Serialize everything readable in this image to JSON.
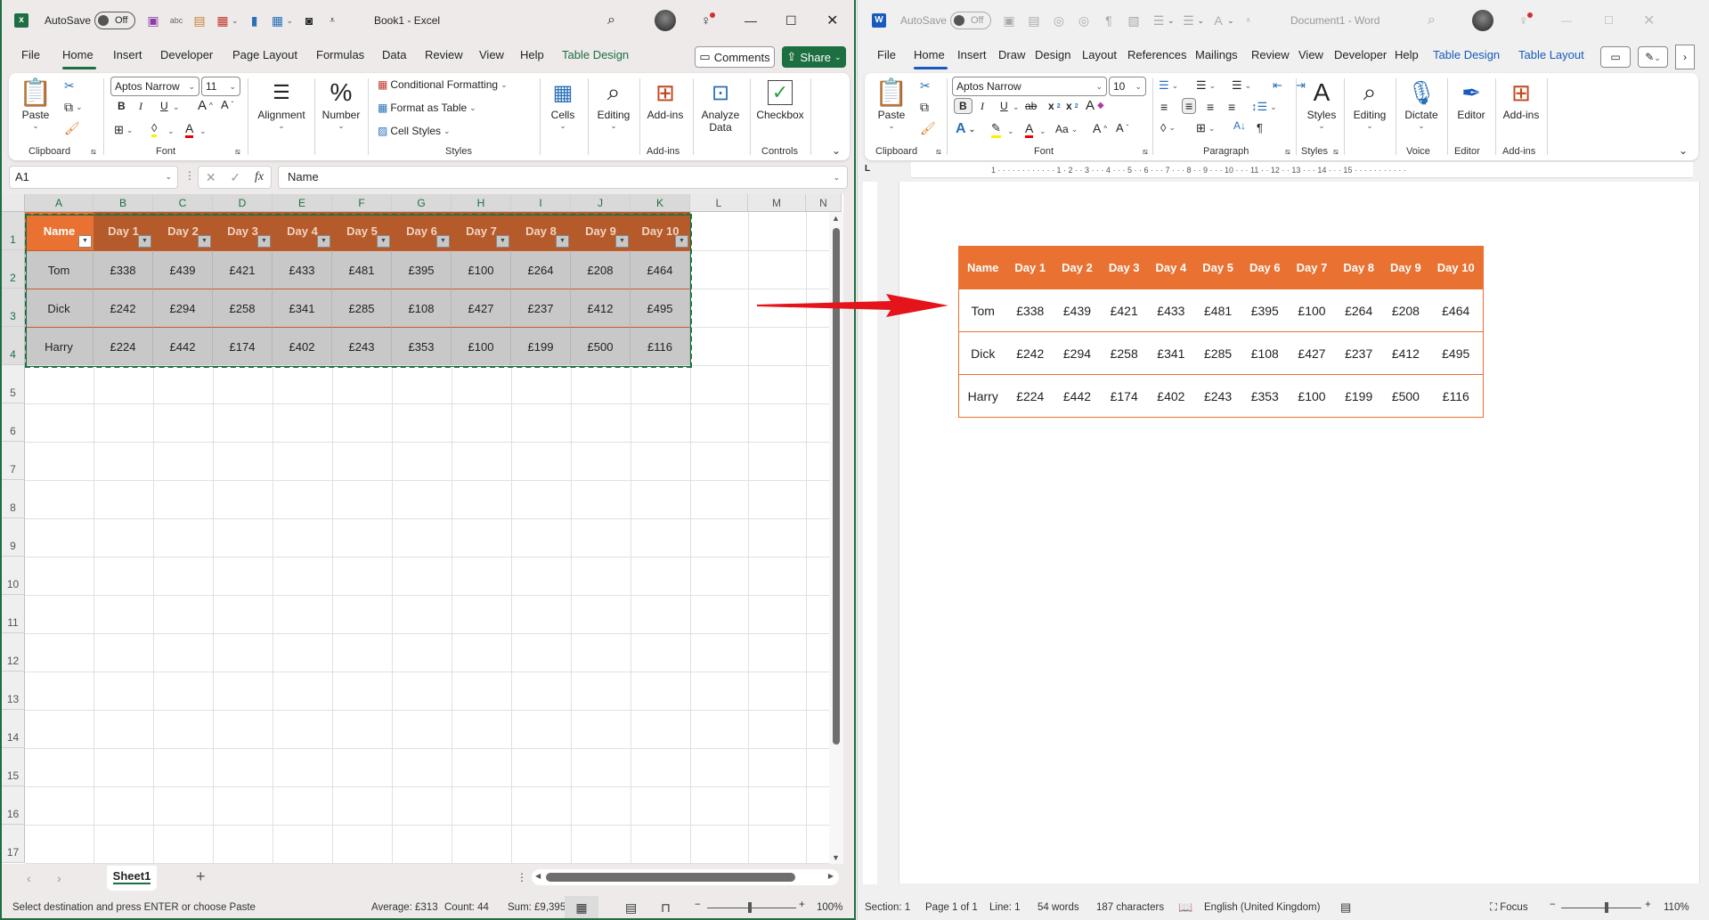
{
  "excel": {
    "title": "Book1  -  Excel",
    "autosave_label": "AutoSave",
    "autosave_state": "Off",
    "tabs": [
      "File",
      "Home",
      "Insert",
      "Developer",
      "Page Layout",
      "Formulas",
      "Data",
      "Review",
      "View",
      "Help",
      "Table Design"
    ],
    "active_tab": "Home",
    "comments_label": "Comments",
    "share_label": "Share",
    "ribbon": {
      "paste": "Paste",
      "clipboard": "Clipboard",
      "font_name": "Aptos Narrow",
      "font_size": "11",
      "font": "Font",
      "alignment": "Alignment",
      "number": "Number",
      "conditional_formatting": "Conditional Formatting",
      "format_as_table": "Format as Table",
      "cell_styles": "Cell Styles",
      "styles": "Styles",
      "cells": "Cells",
      "editing": "Editing",
      "addins": "Add-ins",
      "addins_group": "Add-ins",
      "analyze_data_1": "Analyze",
      "analyze_data_2": "Data",
      "checkbox": "Checkbox",
      "controls": "Controls",
      "bold": "B",
      "italic": "I",
      "underline": "U"
    },
    "name_box": "A1",
    "formula": "Name",
    "columns": [
      "A",
      "B",
      "C",
      "D",
      "E",
      "F",
      "G",
      "H",
      "I",
      "J",
      "K",
      "L",
      "M",
      "N"
    ],
    "rows": [
      "1",
      "2",
      "3",
      "4",
      "5",
      "6",
      "7",
      "8",
      "9",
      "10",
      "11",
      "12",
      "13",
      "14",
      "15",
      "16",
      "17"
    ],
    "sheet_tab": "Sheet1",
    "status": {
      "message": "Select destination and press ENTER or choose Paste",
      "average": "Average: £313",
      "count": "Count: 44",
      "sum": "Sum: £9,395",
      "zoom": "100%"
    },
    "colors": {
      "brand": "#1d6f42",
      "header_dark": "#b55a2a",
      "header_first": "#e97132",
      "body": "#c8c8c8"
    }
  },
  "table": {
    "headers": [
      "Name",
      "Day 1",
      "Day 2",
      "Day 3",
      "Day 4",
      "Day 5",
      "Day 6",
      "Day 7",
      "Day 8",
      "Day 9",
      "Day 10"
    ],
    "rows": [
      [
        "Tom",
        "£338",
        "£439",
        "£421",
        "£433",
        "£481",
        "£395",
        "£100",
        "£264",
        "£208",
        "£464"
      ],
      [
        "Dick",
        "£242",
        "£294",
        "£258",
        "£341",
        "£285",
        "£108",
        "£427",
        "£237",
        "£412",
        "£495"
      ],
      [
        "Harry",
        "£224",
        "£442",
        "£174",
        "£402",
        "£243",
        "£353",
        "£100",
        "£199",
        "£500",
        "£116"
      ]
    ]
  },
  "word": {
    "title": "Document1  -  Word",
    "autosave_label": "AutoSave",
    "autosave_state": "Off",
    "tabs": [
      "File",
      "Home",
      "Insert",
      "Draw",
      "Design",
      "Layout",
      "References",
      "Mailings",
      "Review",
      "View",
      "Developer",
      "Help",
      "Table Design",
      "Table Layout"
    ],
    "active_tab": "Home",
    "ribbon": {
      "paste": "Paste",
      "clipboard": "Clipboard",
      "font_name": "Aptos Narrow",
      "font_size": "10",
      "font": "Font",
      "paragraph": "Paragraph",
      "styles_btn": "Styles",
      "styles": "Styles",
      "editing": "Editing",
      "dictate": "Dictate",
      "voice": "Voice",
      "editor_btn": "Editor",
      "editor": "Editor",
      "addins_btn": "Add-ins",
      "addins": "Add-ins",
      "bold": "B",
      "italic": "I",
      "underline": "U"
    },
    "ruler_marks": "1 · · · · · · · · ·  · · · 1 · 2 · · 3 · · · 4 · · · 5 · · 6 · · · 7 · · · 8 · · 9 · · · 10 · · · 11 · · 12 · · 13 · · · 14 · · · 15 · · · · · · · · · · ·",
    "status": {
      "section": "Section: 1",
      "page": "Page 1 of 1",
      "line": "Line: 1",
      "words": "54 words",
      "characters": "187 characters",
      "language": "English (United Kingdom)",
      "focus": "Focus",
      "zoom": "110%"
    },
    "colors": {
      "brand": "#185abd",
      "table_accent": "#e97132"
    }
  }
}
